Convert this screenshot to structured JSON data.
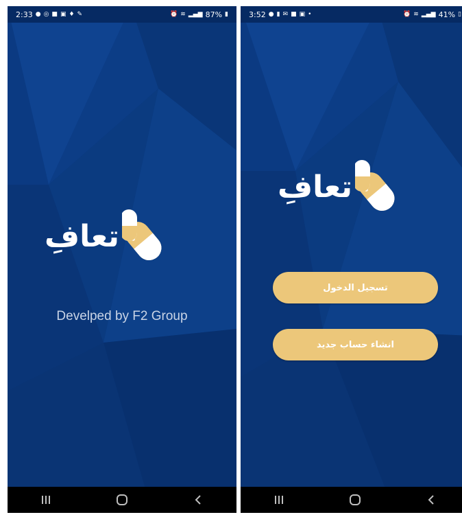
{
  "screens": [
    {
      "status": {
        "time": "2:33",
        "battery": "87%"
      },
      "logo": {
        "text": "تعافِ"
      },
      "footer_text": "Develped by F2 Group"
    },
    {
      "status": {
        "time": "3:52",
        "battery": "41%"
      },
      "logo": {
        "text": "تعافِ"
      },
      "buttons": {
        "login": "تسجيل الدخول",
        "register": "انشاء حساب جديد"
      }
    }
  ],
  "colors": {
    "background": "#0b3a82",
    "accent": "#ecc77a",
    "status_bar": "#062a63",
    "nav_bar": "#000000"
  },
  "icons": {
    "status_left_1": [
      "account-icon",
      "whatsapp-icon",
      "checkbox-icon",
      "image-icon",
      "location-icon",
      "wrench-icon"
    ],
    "status_left_2": [
      "account-icon",
      "pin-icon",
      "mail-icon",
      "checkbox-icon",
      "gallery-icon",
      "dot-icon"
    ],
    "status_right": [
      "alarm-icon",
      "wifi-icon",
      "signal-icon",
      "battery-icon"
    ],
    "nav": [
      "recents-icon",
      "home-icon",
      "back-icon"
    ]
  }
}
